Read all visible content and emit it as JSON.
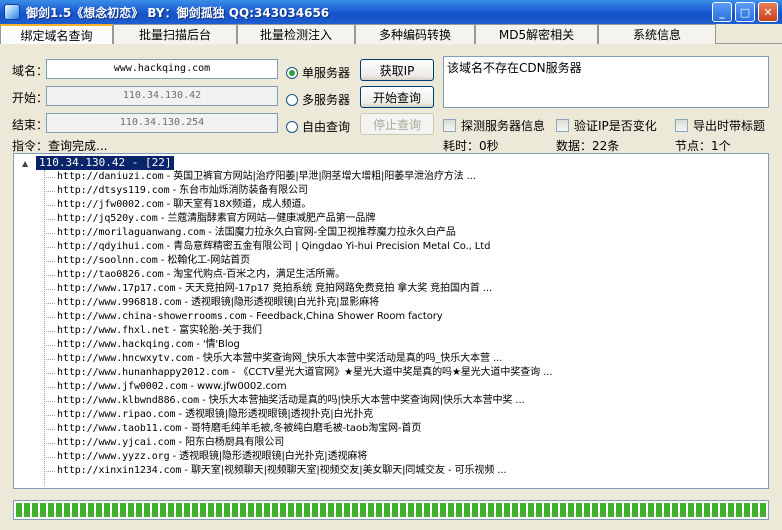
{
  "window": {
    "title": "御剑1.5《想念初恋》 BY：御剑孤独 QQ:343034656"
  },
  "tabs": [
    {
      "label": "绑定域名查询",
      "active": true
    },
    {
      "label": "批量扫描后台",
      "active": false
    },
    {
      "label": "批量检测注入",
      "active": false
    },
    {
      "label": "多种编码转换",
      "active": false
    },
    {
      "label": "MD5解密相关",
      "active": false
    },
    {
      "label": "系统信息",
      "active": false
    }
  ],
  "form": {
    "domain_label": "域名：",
    "domain_value": "www.hackqing.com",
    "start_label": "开始：",
    "start_value": "110.34.130.42",
    "end_label": "结束：",
    "end_value": "110.34.130.254",
    "radio_single": "单服务器",
    "radio_multi": "多服务器",
    "radio_free": "自由查询",
    "btn_get_ip": "获取IP",
    "btn_start": "开始查询",
    "btn_stop": "停止查询",
    "result_text": "该域名不存在CDN服务器"
  },
  "options": {
    "detect_server": "探测服务器信息",
    "verify_ip": "验证IP是否变化",
    "export_title": "导出时带标题"
  },
  "status": {
    "command": "指令：查询完成...",
    "elapsed": "耗时：0秒",
    "data_count": "数据：22条",
    "nodes": "节点：1个"
  },
  "tree": {
    "expander": "▲",
    "root": "110.34.130.42 - [22]",
    "items": [
      {
        "url": "http://daniuzi.com",
        "title": "英国卫裤官方网站|治疗阳萎|早泄|阴茎增大增粗|阳萎早泄治疗方法 ..."
      },
      {
        "url": "http://dtsys119.com",
        "title": "东台市灿烁消防装备有限公司"
      },
      {
        "url": "http://jfw0002.com",
        "title": "聊天室有18X频道，成人频道。"
      },
      {
        "url": "http://jq520y.com",
        "title": "兰蔻清脂酵素官方网站—健康减肥产品第一品牌"
      },
      {
        "url": "http://morilaguanwang.com",
        "title": "法国魔力拉永久白官网-全国卫视推荐魔力拉永久白产品"
      },
      {
        "url": "http://qdyihui.com",
        "title": "青岛意辉精密五金有限公司 | Qingdao Yi-hui Precision Metal Co., Ltd"
      },
      {
        "url": "http://soolnn.com",
        "title": "松翰化工-网站首页"
      },
      {
        "url": "http://tao0826.com",
        "title": "淘宝代购点-百米之内，满足生活所需。"
      },
      {
        "url": "http://www.17p17.com",
        "title": "天天竞拍网-17p17 竞拍系统 竞拍网路免费竞拍 拿大奖 竞拍国内首 ..."
      },
      {
        "url": "http://www.996818.com",
        "title": "透视眼镜|隐形透视眼镜|白光扑克|显影麻将"
      },
      {
        "url": "http://www.china-showerrooms.com",
        "title": "Feedback,China Shower Room factory"
      },
      {
        "url": "http://www.fhxl.net",
        "title": "富实轮胎-关于我们"
      },
      {
        "url": "http://www.hackqing.com",
        "title": "'情'Blog"
      },
      {
        "url": "http://www.hncwxytv.com",
        "title": "快乐大本营中奖查询网_快乐大本营中奖活动是真的吗_快乐大本营 ..."
      },
      {
        "url": "http://www.hunanhappy2012.com",
        "title": "《CCTV星光大道官网》★星光大道中奖是真的吗★星光大道中奖查询 ..."
      },
      {
        "url": "http://www.jfw0002.com",
        "title": "www.jfw0002.com"
      },
      {
        "url": "http://www.klbwnd886.com",
        "title": "快乐大本营抽奖活动是真的吗|快乐大本营中奖查询网|快乐大本营中奖 ..."
      },
      {
        "url": "http://www.ripao.com",
        "title": "透视眼镜|隐形透视眼镜|透视扑克|白光扑克"
      },
      {
        "url": "http://www.taob11.com",
        "title": "哥特磨毛纯羊毛被,冬被纯白磨毛被-taob淘宝网-首页"
      },
      {
        "url": "http://www.yjcai.com",
        "title": "阳东白杨厨具有限公司"
      },
      {
        "url": "http://www.yyzz.org",
        "title": "透视眼镜|隐形透视眼镜|白光扑克|透视麻将"
      },
      {
        "url": "http://xinxin1234.com",
        "title": "聊天室|视频聊天|视频聊天室|视频交友|美女聊天|同城交友 - 可乐视频 ..."
      }
    ]
  },
  "progress": {
    "percent": 100
  },
  "colors": {
    "accent": "#1f63d6",
    "progress": "#3fb12c",
    "selection": "#0a246a"
  }
}
